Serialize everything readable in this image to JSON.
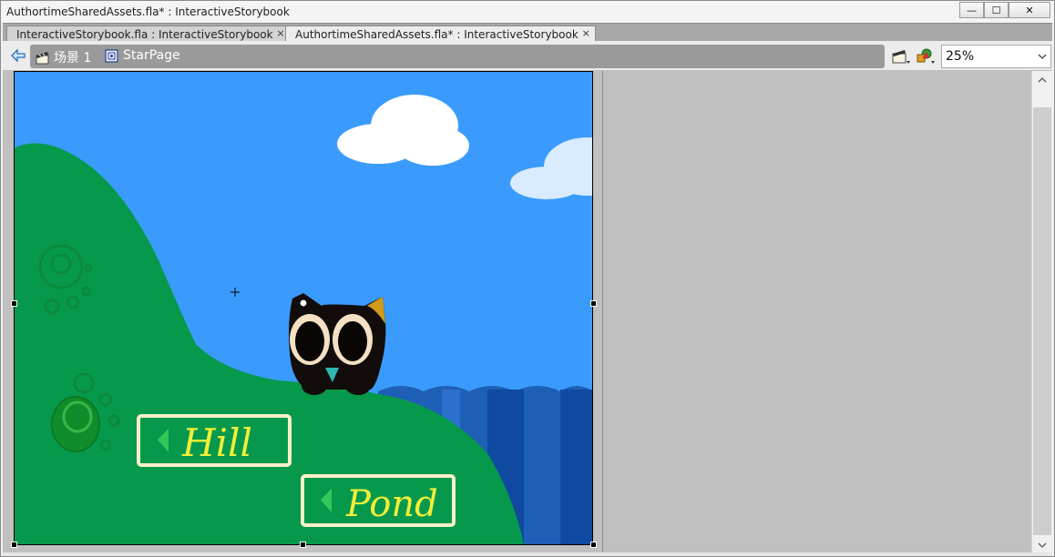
{
  "window": {
    "title": "AuthortimeSharedAssets.fla* : InteractiveStorybook",
    "controls": {
      "minimize": "—",
      "maximize": "☐",
      "close": "✕"
    }
  },
  "tabs": [
    {
      "label": "InteractiveStorybook.fla : InteractiveStorybook",
      "close": "×",
      "active": false
    },
    {
      "label": "AuthortimeSharedAssets.fla* : InteractiveStorybook",
      "close": "×",
      "active": true
    }
  ],
  "editbar": {
    "scene_label": "场景 1",
    "symbol_label": "StarPage",
    "zoom": "25%"
  },
  "stage": {
    "signs": {
      "hill": "Hill",
      "pond": "Pond"
    },
    "colors": {
      "sky": "#3a9bfd",
      "hill": "#06994b",
      "water": "#1e5fb8",
      "sign_text": "#f2ee3a"
    }
  }
}
